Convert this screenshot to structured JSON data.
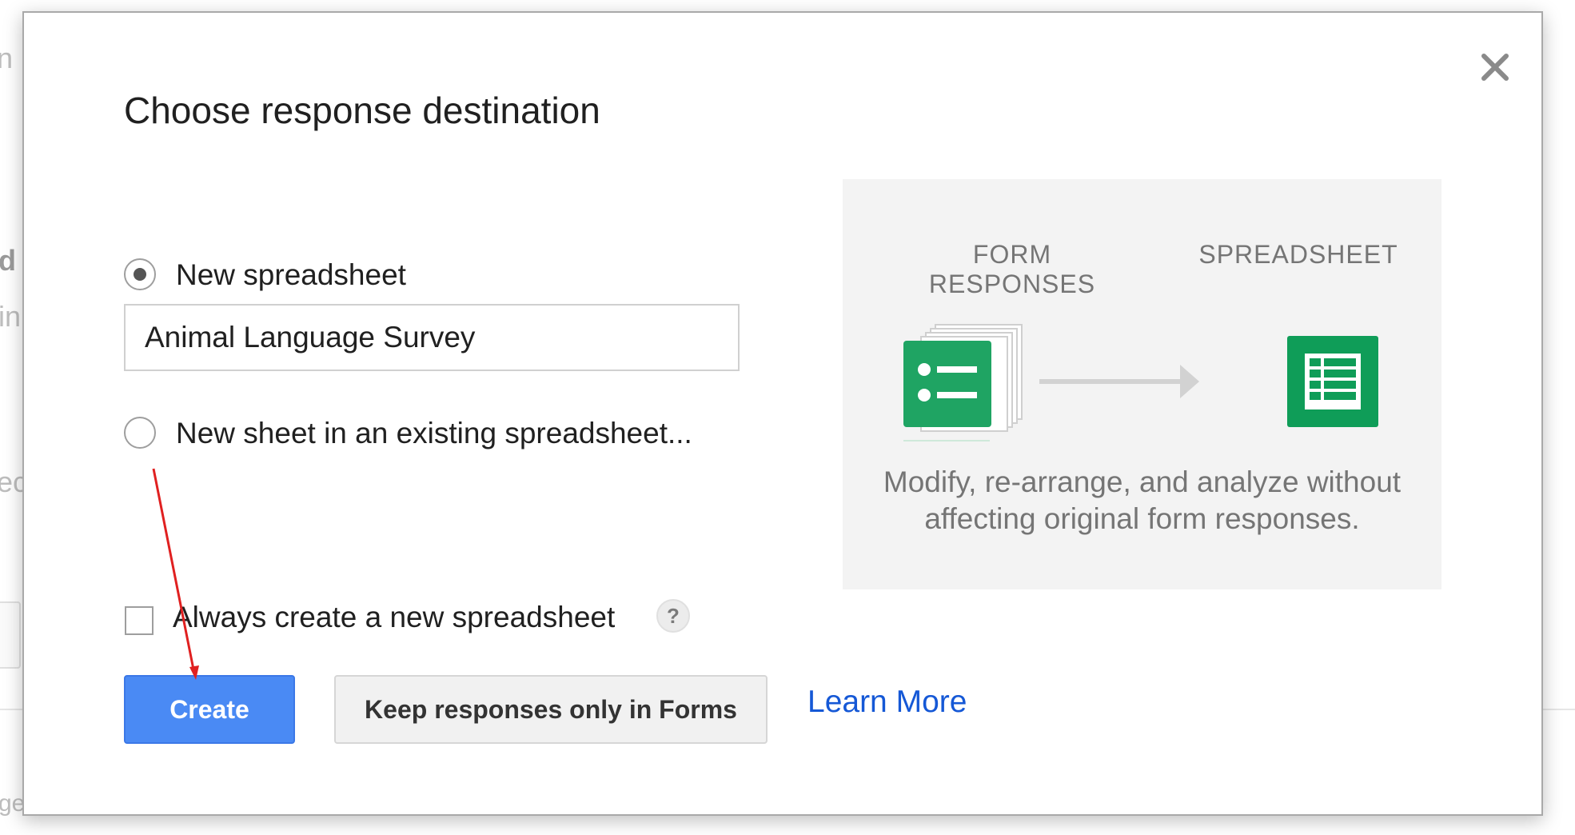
{
  "background": {
    "fragments": [
      "n",
      "d",
      "in",
      "ec",
      "ge"
    ]
  },
  "dialog": {
    "title": "Choose response destination",
    "close_icon": "close-icon",
    "options": [
      {
        "label": "New spreadsheet",
        "selected": true
      },
      {
        "label": "New sheet in an existing spreadsheet...",
        "selected": false
      }
    ],
    "spreadsheet_name": "Animal Language Survey",
    "always_create": {
      "label": "Always create a new spreadsheet",
      "checked": false,
      "help_glyph": "?"
    },
    "buttons": {
      "create": "Create",
      "keep": "Keep responses only in Forms",
      "learn_more": "Learn More"
    },
    "info": {
      "form_caption_line1": "FORM",
      "form_caption_line2": "RESPONSES",
      "sheet_caption": "SPREADSHEET",
      "desc_line1": "Modify, re-arrange, and analyze without",
      "desc_line2": "affecting original form responses."
    },
    "colors": {
      "primary": "#4a8af4",
      "link": "#1558d6",
      "forms_green": "#1fa463",
      "sheets_green": "#0f9d58",
      "annotation": "#e02020"
    }
  }
}
